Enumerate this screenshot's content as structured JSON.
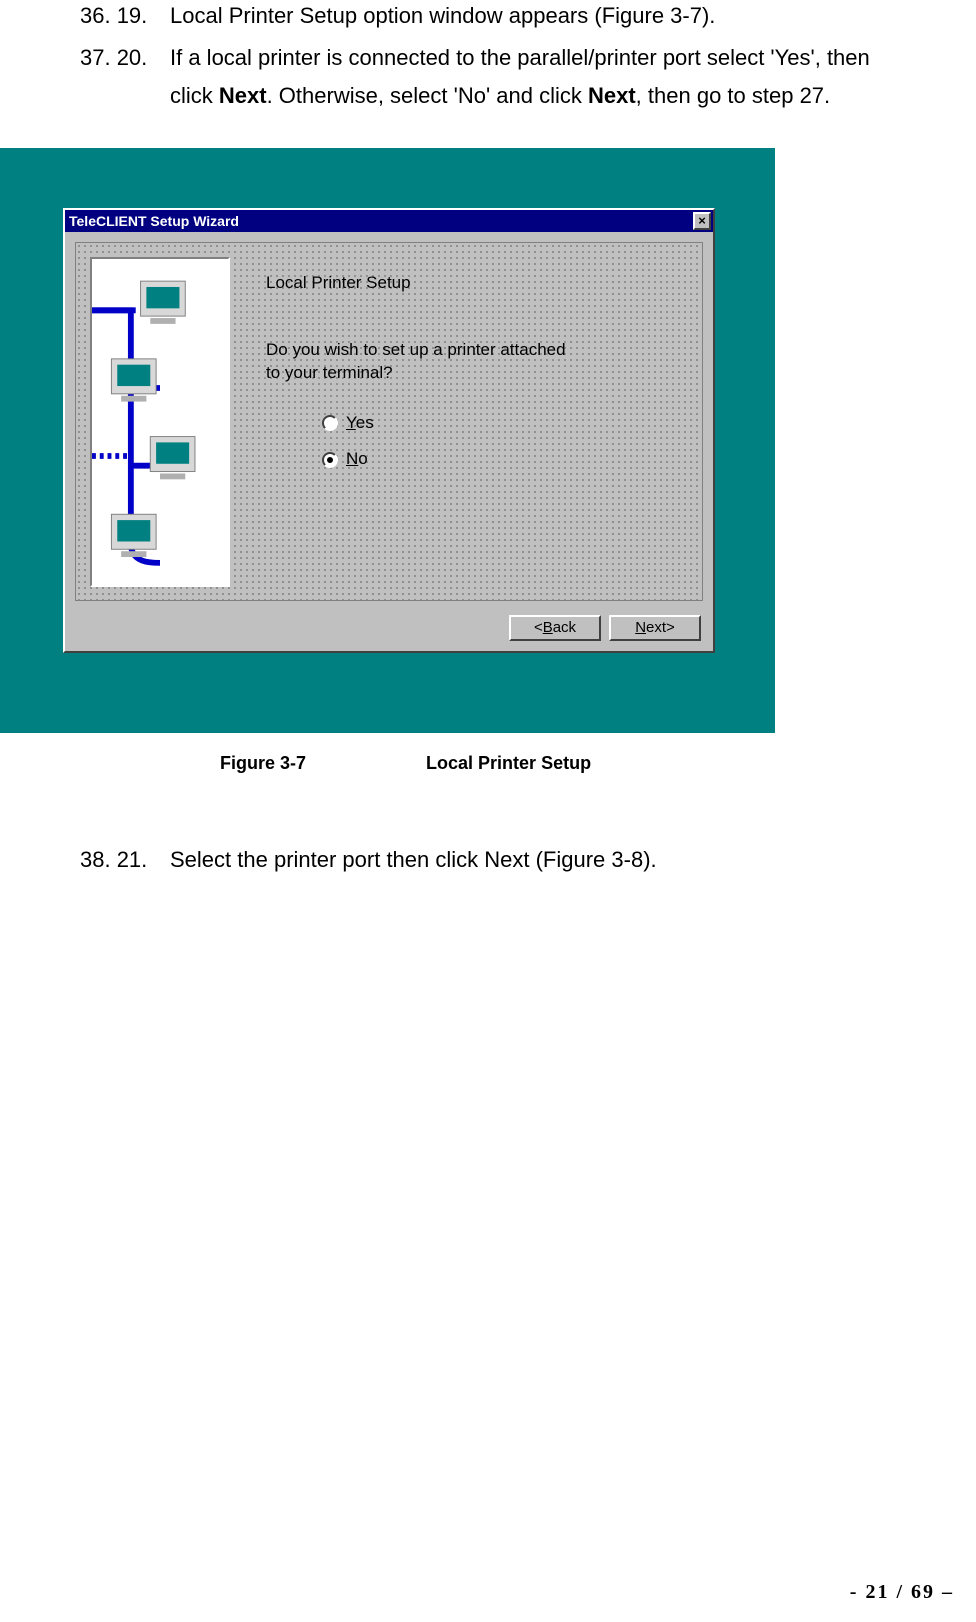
{
  "steps": {
    "a": {
      "num": "36. 19.",
      "text": "Local Printer Setup option window appears (Figure 3-7)."
    },
    "b": {
      "num": "37. 20.",
      "line1_a": "If a local printer is connected to the parallel/printer port select 'Yes', then",
      "line2_a": "click ",
      "next1": "Next",
      "line2_b": ".   Otherwise, select 'No' and click ",
      "next2": "Next",
      "line2_c": ", then go to step 27."
    },
    "c": {
      "num": "38. 21.",
      "text": "Select the printer port then click Next (Figure 3-8)."
    }
  },
  "dialog": {
    "title": "TeleCLIENT Setup Wizard",
    "close": "×",
    "heading": "Local Printer Setup",
    "question": "Do you wish to set up a printer attached to your terminal?",
    "yes_u": "Y",
    "yes_rest": "es",
    "no_u": "N",
    "no_rest": "o",
    "back_lt": "< ",
    "back_u": "B",
    "back_rest": "ack",
    "next_u": "N",
    "next_rest": "ext ",
    "next_gt": ">"
  },
  "caption": {
    "fig": "Figure 3-7",
    "title": "Local Printer Setup"
  },
  "footer": "- 21 / 69 –"
}
